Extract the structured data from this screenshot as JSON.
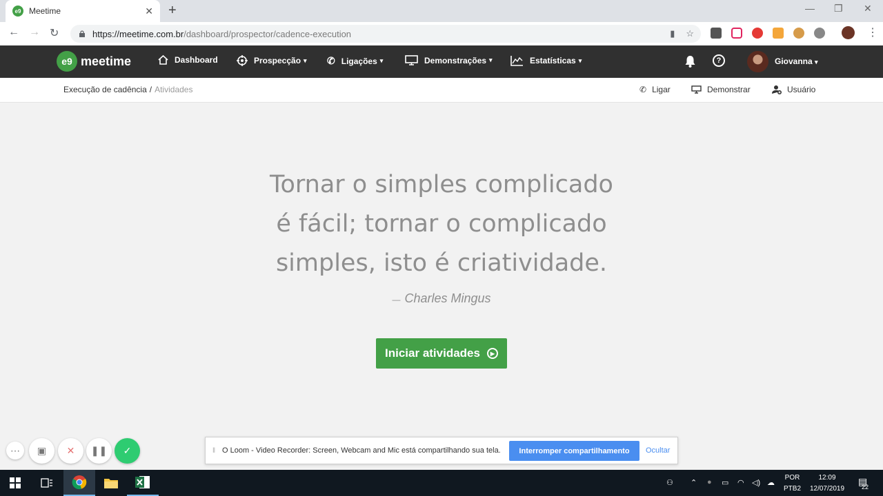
{
  "browser": {
    "tab_title": "Meetime",
    "favicon_text": "e9",
    "url_host": "https://meetime.com.br",
    "url_path": "/dashboard/prospector/cadence-execution"
  },
  "app": {
    "logo_mark": "e9",
    "logo_text": "meetime",
    "brand_color": "#43a047",
    "nav": [
      {
        "label": "Dashboard",
        "icon": "home-icon"
      },
      {
        "label": "Prospecção",
        "icon": "target-icon"
      },
      {
        "label": "Ligações",
        "icon": "phone-icon"
      },
      {
        "label": "Demonstrações",
        "icon": "monitor-icon"
      },
      {
        "label": "Estatísticas",
        "icon": "chart-icon"
      }
    ],
    "user_name": "Giovanna",
    "help_symbol": "?"
  },
  "subheader": {
    "breadcrumb_parent": "Execução de cadência",
    "breadcrumb_sep": "/",
    "breadcrumb_current": "Atividades",
    "actions": [
      {
        "label": "Ligar",
        "icon": "phone-icon"
      },
      {
        "label": "Demonstrar",
        "icon": "monitor-icon"
      },
      {
        "label": "Usuário",
        "icon": "add-user-icon"
      }
    ]
  },
  "main": {
    "quote_lines": [
      "Tornar o simples complicado",
      "é fácil; tornar o complicado",
      "simples, isto é criatividade."
    ],
    "author_dash": "—",
    "author": "Charles Mingus",
    "start_button": "Iniciar atividades"
  },
  "loom": {
    "message": "O Loom - Video Recorder: Screen, Webcam and Mic está compartilhando sua tela.",
    "stop_label": "Interromper compartilhamento",
    "hide_label": "Ocultar",
    "accent": "#4a8ef0"
  },
  "taskbar": {
    "lang_line1": "POR",
    "lang_line2": "PTB2",
    "time": "12:09",
    "date": "12/07/2019",
    "notifications": "22"
  }
}
